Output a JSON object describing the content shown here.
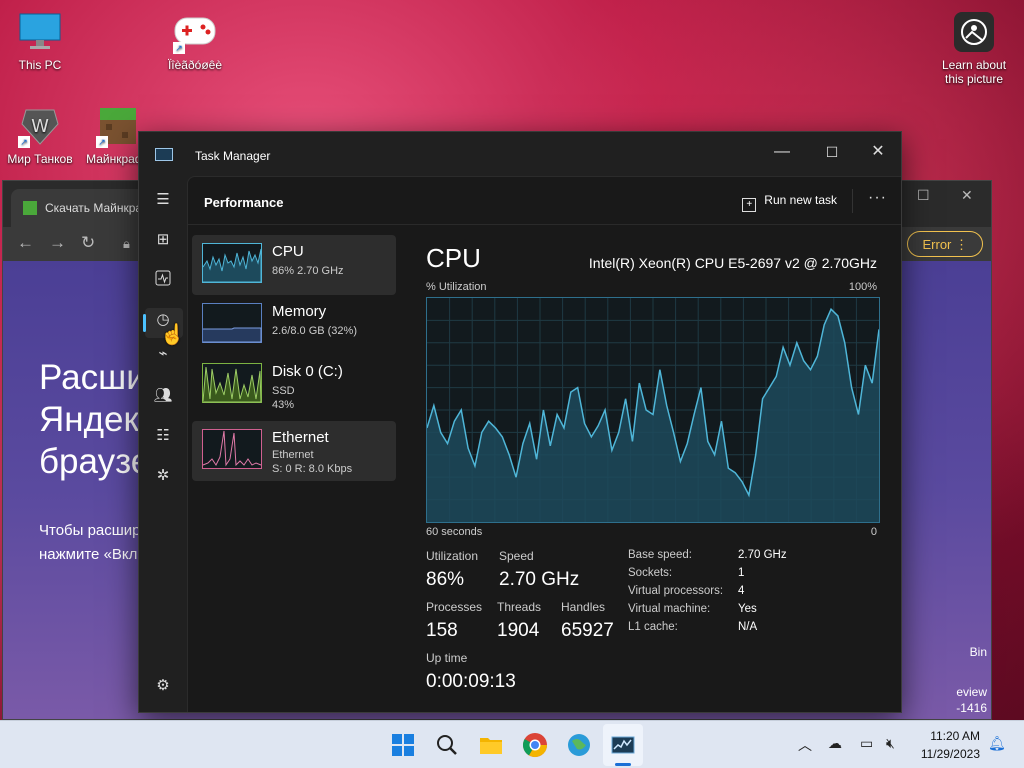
{
  "desktop": {
    "icons": [
      {
        "label": "This PC",
        "icon": "monitor-icon"
      },
      {
        "label": "Ïîèãðóøêè",
        "icon": "gamepad-icon"
      },
      {
        "label": "Мир Танков",
        "icon": "tank-game-icon"
      },
      {
        "label": "Майнкрафт",
        "icon": "minecraft-icon"
      },
      {
        "label_line1": "Learn about",
        "label_line2": "this picture",
        "icon": "camera-learn-icon"
      }
    ]
  },
  "browser": {
    "tab_title": "Скачать Майнкрафт",
    "error_label": "Error",
    "promo_title_lines": [
      "Расширения в",
      "Яндекс",
      "браузере"
    ],
    "promo_text_lines": [
      "Чтобы расширить возможности",
      "нажмите «Включить»"
    ],
    "right_snippets": [
      "Bin",
      "eview",
      "-1416"
    ]
  },
  "task_manager": {
    "title": "Task Manager",
    "page_title": "Performance",
    "run_new_task": "Run new task",
    "more_label": "···",
    "devices": [
      {
        "name": "CPU",
        "sub1": "86% 2.70 GHz",
        "sub2": ""
      },
      {
        "name": "Memory",
        "sub1": "2.6/8.0 GB (32%)",
        "sub2": ""
      },
      {
        "name": "Disk 0 (C:)",
        "sub1": "SSD",
        "sub2": "43%"
      },
      {
        "name": "Ethernet",
        "sub1": "Ethernet",
        "sub2": "S: 0 R: 8.0 Kbps"
      }
    ],
    "cpu": {
      "heading": "CPU",
      "model": "Intel(R) Xeon(R) CPU E5-2697 v2 @ 2.70GHz",
      "util_axis_label": "% Utilization",
      "max_label": "100%",
      "time_label": "60 seconds",
      "min_label": "0",
      "utilization_label": "Utilization",
      "utilization_value": "86%",
      "speed_label": "Speed",
      "speed_value": "2.70 GHz",
      "processes_label": "Processes",
      "processes_value": "158",
      "threads_label": "Threads",
      "threads_value": "1904",
      "handles_label": "Handles",
      "handles_value": "65927",
      "uptime_label": "Up time",
      "uptime_value": "0:00:09:13",
      "specs": [
        {
          "key": "Base speed:",
          "value": "2.70 GHz"
        },
        {
          "key": "Sockets:",
          "value": "1"
        },
        {
          "key": "Virtual processors:",
          "value": "4"
        },
        {
          "key": "Virtual machine:",
          "value": "Yes"
        },
        {
          "key": "L1 cache:",
          "value": "N/A"
        }
      ],
      "history_percent": [
        42,
        52,
        40,
        35,
        45,
        50,
        33,
        25,
        40,
        45,
        42,
        38,
        30,
        20,
        35,
        44,
        28,
        50,
        34,
        48,
        42,
        58,
        60,
        44,
        38,
        43,
        50,
        32,
        40,
        55,
        36,
        62,
        50,
        48,
        68,
        52,
        40,
        27,
        35,
        48,
        60,
        36,
        30,
        45,
        24,
        22,
        18,
        12,
        30,
        55,
        60,
        65,
        78,
        70,
        80,
        72,
        68,
        74,
        88,
        95,
        92,
        80,
        60,
        48,
        70,
        62,
        86
      ]
    },
    "colors": {
      "cpu_line": "#4fb6d8",
      "cpu_fill": "#1d4a5c",
      "graph_border": "#2e6f8c",
      "accent": "#4cc2ff"
    }
  },
  "taskbar": {
    "apps": [
      "windows-start-icon",
      "search-icon",
      "file-explorer-icon",
      "chrome-icon",
      "globe-app-icon",
      "task-manager-icon"
    ],
    "time": "11:20 AM",
    "date": "11/29/2023"
  }
}
